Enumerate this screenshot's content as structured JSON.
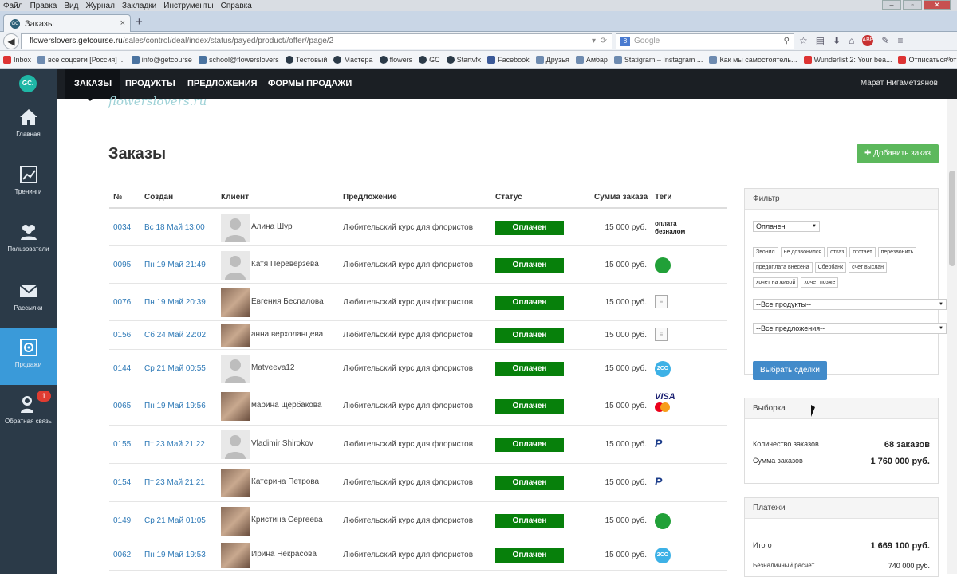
{
  "browser": {
    "menu": [
      "Файл",
      "Правка",
      "Вид",
      "Журнал",
      "Закладки",
      "Инструменты",
      "Справка"
    ],
    "tab_title": "Заказы",
    "tab_favicon": "GC",
    "url_host": "flowerslovers.getcourse.ru",
    "url_path": "/sales/control/deal/index/status/payed/product//offer//page/2",
    "search_placeholder": "Google",
    "search_engine_icon": "8",
    "abp_label": "ABP",
    "bookmarks": [
      {
        "icon": "gm",
        "label": "Inbox"
      },
      {
        "icon": "bl",
        "label": "все соцсети [Россия] ..."
      },
      {
        "icon": "mail",
        "label": "info@getcourse"
      },
      {
        "icon": "mail",
        "label": "school@flowerslovers"
      },
      {
        "icon": "gc",
        "label": "Тестовый"
      },
      {
        "icon": "gc",
        "label": "Мастера"
      },
      {
        "icon": "gc",
        "label": "flowers"
      },
      {
        "icon": "gc",
        "label": "GC"
      },
      {
        "icon": "gc",
        "label": "Startvfx"
      },
      {
        "icon": "fb",
        "label": "Facebook"
      },
      {
        "icon": "bl",
        "label": "Друзья"
      },
      {
        "icon": "bl",
        "label": "Амбар"
      },
      {
        "icon": "bl",
        "label": "Statigram – Instagram ..."
      },
      {
        "icon": "bl",
        "label": "Как мы самостоятель..."
      },
      {
        "icon": "gm",
        "label": "Wunderlist 2: Your bea..."
      },
      {
        "icon": "gm",
        "label": "Отписаться от СМС-р..."
      }
    ]
  },
  "app": {
    "logo": "GC.",
    "sidebar": [
      {
        "label": "Главная",
        "icon": "home-icon"
      },
      {
        "label": "Тренинги",
        "icon": "chart-icon"
      },
      {
        "label": "Пользователи",
        "icon": "users-icon"
      },
      {
        "label": "Рассылки",
        "icon": "envelope-icon"
      },
      {
        "label": "Продажи",
        "icon": "safe-icon",
        "active": true
      },
      {
        "label": "Обратная связь",
        "icon": "feedback-icon",
        "badge": "1"
      }
    ],
    "topnav": [
      "ЗАКАЗЫ",
      "ПРОДУКТЫ",
      "ПРЕДЛОЖЕНИЯ",
      "ФОРМЫ ПРОДАЖИ"
    ],
    "username": "Марат Нигаметзянов",
    "brand_text": "flowerslovers.ru"
  },
  "page": {
    "title": "Заказы",
    "add_button": "Добавить заказ",
    "add_button_icon": "plus-icon"
  },
  "orders": {
    "columns": [
      "№",
      "Создан",
      "Клиент",
      "Предложение",
      "Статус",
      "Сумма заказа",
      "Теги"
    ],
    "rows": [
      {
        "num": "0034",
        "date": "Вс 18 Май 13:00",
        "client": "Алина Шур",
        "avatar": "none",
        "offer": "Любительский курс для флористов",
        "status": "Оплачен",
        "sum": "15 000 руб.",
        "tag_type": "text",
        "tag": "оплата безналом"
      },
      {
        "num": "0095",
        "date": "Пн 19 Май 21:49",
        "client": "Катя Переверзева",
        "avatar": "none",
        "offer": "Любительский курс для флористов",
        "status": "Оплачен",
        "sum": "15 000 руб.",
        "tag_type": "sber",
        "tag": ""
      },
      {
        "num": "0076",
        "date": "Пн 19 Май 20:39",
        "client": "Евгения Беспалова",
        "avatar": "photo",
        "offer": "Любительский курс для флористов",
        "status": "Оплачен",
        "sum": "15 000 руб.",
        "tag_type": "doc",
        "tag": ""
      },
      {
        "num": "0156",
        "date": "Сб 24 Май 22:02",
        "client": "анна верхоланцева",
        "avatar": "photo",
        "offer": "Любительский курс для флористов",
        "status": "Оплачен",
        "sum": "15 000 руб.",
        "tag_type": "doc",
        "tag": ""
      },
      {
        "num": "0144",
        "date": "Ср 21 Май 00:55",
        "client": "Matveeva12",
        "avatar": "none",
        "offer": "Любительский курс для флористов",
        "status": "Оплачен",
        "sum": "15 000 руб.",
        "tag_type": "twoco",
        "tag": "2CO"
      },
      {
        "num": "0065",
        "date": "Пн 19 Май 19:56",
        "client": "марина щербакова",
        "avatar": "photo",
        "offer": "Любительский курс для флористов",
        "status": "Оплачен",
        "sum": "15 000 руб.",
        "tag_type": "visa",
        "tag": "VISA"
      },
      {
        "num": "0155",
        "date": "Пт 23 Май 21:22",
        "client": "Vladimir Shirokov",
        "avatar": "none",
        "offer": "Любительский курс для флористов",
        "status": "Оплачен",
        "sum": "15 000 руб.",
        "tag_type": "paypal",
        "tag": "P"
      },
      {
        "num": "0154",
        "date": "Пт 23 Май 21:21",
        "client": "Катерина Петрова",
        "avatar": "photo",
        "offer": "Любительский курс для флористов",
        "status": "Оплачен",
        "sum": "15 000 руб.",
        "tag_type": "paypal",
        "tag": "P"
      },
      {
        "num": "0149",
        "date": "Ср 21 Май 01:05",
        "client": "Кристина Сергеева",
        "avatar": "photo",
        "offer": "Любительский курс для флористов",
        "status": "Оплачен",
        "sum": "15 000 руб.",
        "tag_type": "sber",
        "tag": ""
      },
      {
        "num": "0062",
        "date": "Пн 19 Май 19:53",
        "client": "Ирина Некрасова",
        "avatar": "photo",
        "offer": "Любительский курс для флористов",
        "status": "Оплачен",
        "sum": "15 000 руб.",
        "tag_type": "twoco",
        "tag": "2CO"
      }
    ]
  },
  "filter": {
    "title": "Фильтр",
    "status_select": "Оплачен",
    "tags": [
      "Звонил",
      "не дозвонился",
      "отказ",
      "отстает",
      "перезвонить",
      "предоплата внесена",
      "Сбербанк",
      "счет выслан",
      "хочет на живой",
      "хочет позже"
    ],
    "products_select": "--Все продукты--",
    "offers_select": "--Все предложения--",
    "submit": "Выбрать сделки"
  },
  "selection": {
    "title": "Выборка",
    "count_label": "Количество заказов",
    "count_value": "68 заказов",
    "sum_label": "Сумма заказов",
    "sum_value": "1 760 000 руб."
  },
  "payments": {
    "title": "Платежи",
    "total_label": "Итого",
    "total_value": "1 669 100 руб.",
    "cashless_label": "Безналичный расчёт",
    "cashless_value": "740 000 руб."
  },
  "colors": {
    "paid": "#07800b",
    "accent": "#3a9ad9",
    "sidebar": "#2b3a48",
    "link": "#2f7ab7"
  }
}
